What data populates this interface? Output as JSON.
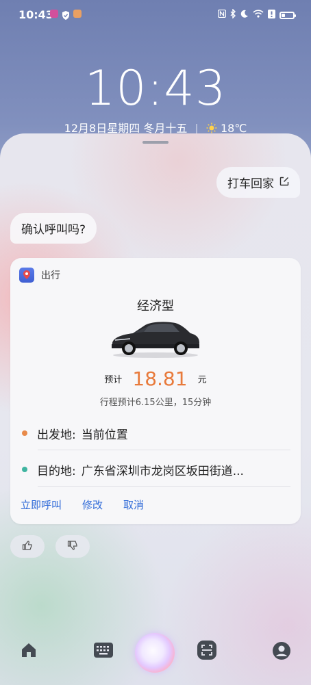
{
  "status_bar": {
    "time": "10:43",
    "left_icons": [
      "app-notification-icon",
      "shield-check-icon",
      "message-icon"
    ],
    "right_icons": [
      "nfc-icon",
      "bluetooth-icon",
      "moon-icon",
      "wifi-icon",
      "alert-icon",
      "battery-icon"
    ]
  },
  "lock": {
    "clock": "10:43",
    "date": "12月8日星期四",
    "lunar": "冬月十五",
    "weather_icon": "sun-icon",
    "temperature": "18℃"
  },
  "chat": {
    "user_message": "打车回家",
    "assistant_message": "确认呼叫吗?"
  },
  "card": {
    "app_name": "出行",
    "car_type": "经济型",
    "price_label": "预计",
    "price": "18.81",
    "price_unit": "元",
    "trip_info": "行程预计6.15公里，15分钟",
    "origin_label": "出发地:",
    "origin_value": "当前位置",
    "destination_label": "目的地:",
    "destination_value": "广东省深圳市龙岗区坂田街道...",
    "actions": {
      "call": "立即呼叫",
      "edit": "修改",
      "cancel": "取消"
    }
  },
  "colors": {
    "price": "#e87a3b",
    "origin_dot": "#e88a4a",
    "destination_dot": "#3fb4a0",
    "action_link": "#2f6ad8"
  },
  "bottom_nav": [
    "home-icon",
    "keyboard-icon",
    "voice-assistant-orb",
    "scan-icon",
    "profile-icon"
  ]
}
